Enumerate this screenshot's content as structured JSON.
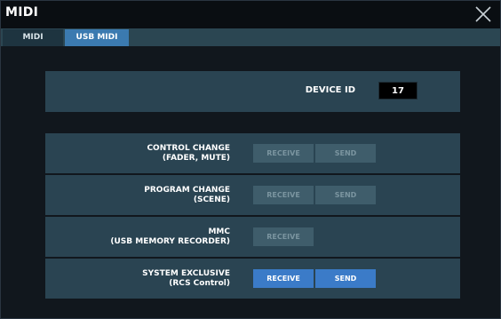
{
  "window": {
    "title": "MIDI"
  },
  "tabs": [
    {
      "label": "MIDI",
      "active": false
    },
    {
      "label": "USB MIDI",
      "active": true
    }
  ],
  "device": {
    "label": "DEVICE ID",
    "value": "17"
  },
  "rows": [
    {
      "line1": "CONTROL CHANGE",
      "line2": "(FADER, MUTE)",
      "receive": "RECEIVE",
      "send": "SEND",
      "receive_on": false,
      "send_on": false
    },
    {
      "line1": "PROGRAM CHANGE",
      "line2": "(SCENE)",
      "receive": "RECEIVE",
      "send": "SEND",
      "receive_on": false,
      "send_on": false
    },
    {
      "line1": "MMC",
      "line2": "(USB MEMORY RECORDER)",
      "receive": "RECEIVE",
      "receive_on": false
    },
    {
      "line1": "SYSTEM EXCLUSIVE",
      "line2": "(RCS Control)",
      "receive": "RECEIVE",
      "send": "SEND",
      "receive_on": true,
      "send_on": true
    }
  ],
  "colors": {
    "accent": "#3b7bc8",
    "panel": "#2a4452",
    "background": "#11171d"
  }
}
